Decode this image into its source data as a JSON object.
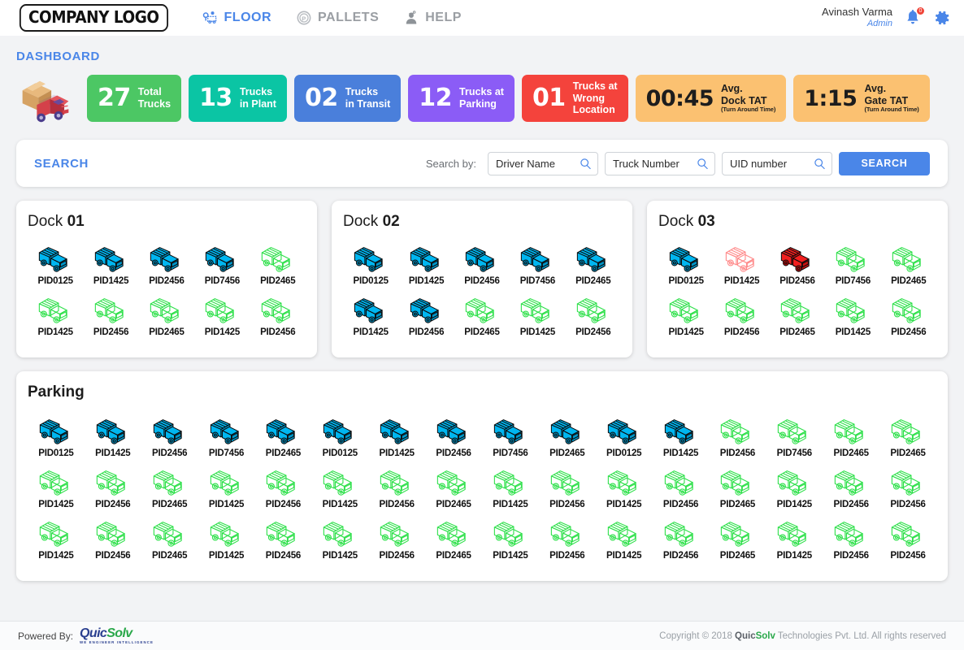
{
  "header": {
    "logo_text": "COMPANY LOGO",
    "nav": [
      {
        "label": "FLOOR",
        "icon": "location-pin-truck-icon",
        "active": true
      },
      {
        "label": "PALLETS",
        "icon": "pallet-circle-p-icon",
        "active": false
      },
      {
        "label": "HELP",
        "icon": "person-headset-icon",
        "active": false
      }
    ],
    "user": {
      "name": "Avinash Varma",
      "role": "Admin"
    },
    "notification_count": "0",
    "icons": [
      "bell-icon",
      "gear-icon"
    ]
  },
  "dashboard": {
    "title": "DASHBOARD",
    "kpis": [
      {
        "value": "27",
        "label_line1": "Total",
        "label_line2": "Trucks",
        "label_line3": "",
        "sub": "",
        "color": "#4cc764",
        "text": "light"
      },
      {
        "value": "13",
        "label_line1": "Trucks",
        "label_line2": "in Plant",
        "label_line3": "",
        "sub": "",
        "color": "#0bc5a4",
        "text": "light"
      },
      {
        "value": "02",
        "label_line1": "Trucks",
        "label_line2": "in Transit",
        "label_line3": "",
        "sub": "",
        "color": "#4a7fdb",
        "text": "light"
      },
      {
        "value": "12",
        "label_line1": "Trucks at",
        "label_line2": "Parking",
        "label_line3": "",
        "sub": "",
        "color": "#8b5cf6",
        "text": "light"
      },
      {
        "value": "01",
        "label_line1": "Trucks at",
        "label_line2": "Wrong",
        "label_line3": "Location",
        "sub": "",
        "color": "#f4433c",
        "text": "light"
      },
      {
        "value": "00:45",
        "label_line1": "Avg.",
        "label_line2": "Dock TAT",
        "label_line3": "",
        "sub": "(Turn Around Time)",
        "color": "#fbc171",
        "text": "dark"
      },
      {
        "value": "1:15",
        "label_line1": "Avg.",
        "label_line2": "Gate TAT",
        "label_line3": "",
        "sub": "(Turn Around Time)",
        "color": "#fbc171",
        "text": "dark"
      }
    ]
  },
  "search": {
    "title": "SEARCH",
    "search_by_label": "Search by:",
    "fields": [
      {
        "name": "driver-name",
        "placeholder": "Driver Name",
        "value": ""
      },
      {
        "name": "truck-number",
        "placeholder": "Truck Number",
        "value": ""
      },
      {
        "name": "uid-number",
        "placeholder": "UID number",
        "value": ""
      }
    ],
    "button_label": "SEARCH"
  },
  "docks": [
    {
      "title_prefix": "Dock ",
      "title_number": "01",
      "trucks": [
        {
          "pid": "PID0125",
          "state": "cyan"
        },
        {
          "pid": "PID1425",
          "state": "cyan"
        },
        {
          "pid": "PID2456",
          "state": "cyan"
        },
        {
          "pid": "PID7456",
          "state": "cyan"
        },
        {
          "pid": "PID2465",
          "state": "green"
        },
        {
          "pid": "PID1425",
          "state": "green"
        },
        {
          "pid": "PID2456",
          "state": "green"
        },
        {
          "pid": "PID2465",
          "state": "green"
        },
        {
          "pid": "PID1425",
          "state": "green"
        },
        {
          "pid": "PID2456",
          "state": "green"
        }
      ]
    },
    {
      "title_prefix": "Dock ",
      "title_number": "02",
      "trucks": [
        {
          "pid": "PID0125",
          "state": "cyan"
        },
        {
          "pid": "PID1425",
          "state": "cyan"
        },
        {
          "pid": "PID2456",
          "state": "cyan"
        },
        {
          "pid": "PID7456",
          "state": "cyan"
        },
        {
          "pid": "PID2465",
          "state": "cyan"
        },
        {
          "pid": "PID1425",
          "state": "cyan"
        },
        {
          "pid": "PID2456",
          "state": "cyan"
        },
        {
          "pid": "PID2465",
          "state": "green"
        },
        {
          "pid": "PID1425",
          "state": "green"
        },
        {
          "pid": "PID2456",
          "state": "green"
        }
      ]
    },
    {
      "title_prefix": "Dock ",
      "title_number": "03",
      "trucks": [
        {
          "pid": "PID0125",
          "state": "cyan"
        },
        {
          "pid": "PID1425",
          "state": "red-outline"
        },
        {
          "pid": "PID2456",
          "state": "red"
        },
        {
          "pid": "PID7456",
          "state": "green"
        },
        {
          "pid": "PID2465",
          "state": "green"
        },
        {
          "pid": "PID1425",
          "state": "green"
        },
        {
          "pid": "PID2456",
          "state": "green"
        },
        {
          "pid": "PID2465",
          "state": "green"
        },
        {
          "pid": "PID1425",
          "state": "green"
        },
        {
          "pid": "PID2456",
          "state": "green"
        }
      ]
    }
  ],
  "parking": {
    "title": "Parking",
    "trucks": [
      {
        "pid": "PID0125",
        "state": "cyan"
      },
      {
        "pid": "PID1425",
        "state": "cyan"
      },
      {
        "pid": "PID2456",
        "state": "cyan"
      },
      {
        "pid": "PID7456",
        "state": "cyan"
      },
      {
        "pid": "PID2465",
        "state": "cyan"
      },
      {
        "pid": "PID0125",
        "state": "cyan"
      },
      {
        "pid": "PID1425",
        "state": "cyan"
      },
      {
        "pid": "PID2456",
        "state": "cyan"
      },
      {
        "pid": "PID7456",
        "state": "cyan"
      },
      {
        "pid": "PID2465",
        "state": "cyan"
      },
      {
        "pid": "PID0125",
        "state": "cyan"
      },
      {
        "pid": "PID1425",
        "state": "cyan"
      },
      {
        "pid": "PID2456",
        "state": "green"
      },
      {
        "pid": "PID7456",
        "state": "green"
      },
      {
        "pid": "PID2465",
        "state": "green"
      },
      {
        "pid": "PID2465",
        "state": "green"
      },
      {
        "pid": "PID1425",
        "state": "green"
      },
      {
        "pid": "PID2456",
        "state": "green"
      },
      {
        "pid": "PID2465",
        "state": "green"
      },
      {
        "pid": "PID1425",
        "state": "green"
      },
      {
        "pid": "PID2456",
        "state": "green"
      },
      {
        "pid": "PID1425",
        "state": "green"
      },
      {
        "pid": "PID2456",
        "state": "green"
      },
      {
        "pid": "PID2465",
        "state": "green"
      },
      {
        "pid": "PID1425",
        "state": "green"
      },
      {
        "pid": "PID2456",
        "state": "green"
      },
      {
        "pid": "PID1425",
        "state": "green"
      },
      {
        "pid": "PID2456",
        "state": "green"
      },
      {
        "pid": "PID2465",
        "state": "green"
      },
      {
        "pid": "PID1425",
        "state": "green"
      },
      {
        "pid": "PID2456",
        "state": "green"
      },
      {
        "pid": "PID2456",
        "state": "green"
      },
      {
        "pid": "PID1425",
        "state": "green"
      },
      {
        "pid": "PID2456",
        "state": "green"
      },
      {
        "pid": "PID2465",
        "state": "green"
      },
      {
        "pid": "PID1425",
        "state": "green"
      },
      {
        "pid": "PID2456",
        "state": "green"
      },
      {
        "pid": "PID1425",
        "state": "green"
      },
      {
        "pid": "PID2456",
        "state": "green"
      },
      {
        "pid": "PID2465",
        "state": "green"
      },
      {
        "pid": "PID1425",
        "state": "green"
      },
      {
        "pid": "PID2456",
        "state": "green"
      },
      {
        "pid": "PID1425",
        "state": "green"
      },
      {
        "pid": "PID2456",
        "state": "green"
      },
      {
        "pid": "PID2465",
        "state": "green"
      },
      {
        "pid": "PID1425",
        "state": "green"
      },
      {
        "pid": "PID2456",
        "state": "green"
      },
      {
        "pid": "PID2456",
        "state": "green"
      }
    ]
  },
  "footer": {
    "powered_by": "Powered By:",
    "brand_part1": "Quic",
    "brand_part2": "Solv",
    "brand_tagline": "WE ENGINEER INTELLIGENCE",
    "copyright_pre": "Copyright © 2018 ",
    "copyright_brand1": "Quic",
    "copyright_brand2": "Solv",
    "copyright_post": " Technologies Pvt. Ltd. All rights reserved"
  },
  "colors": {
    "accent": "#4a86e8",
    "truck_cyan": "#00b6f0",
    "truck_green": "#2ee04a",
    "truck_red": "#f01f1f",
    "bg": "#f2f3f5"
  }
}
